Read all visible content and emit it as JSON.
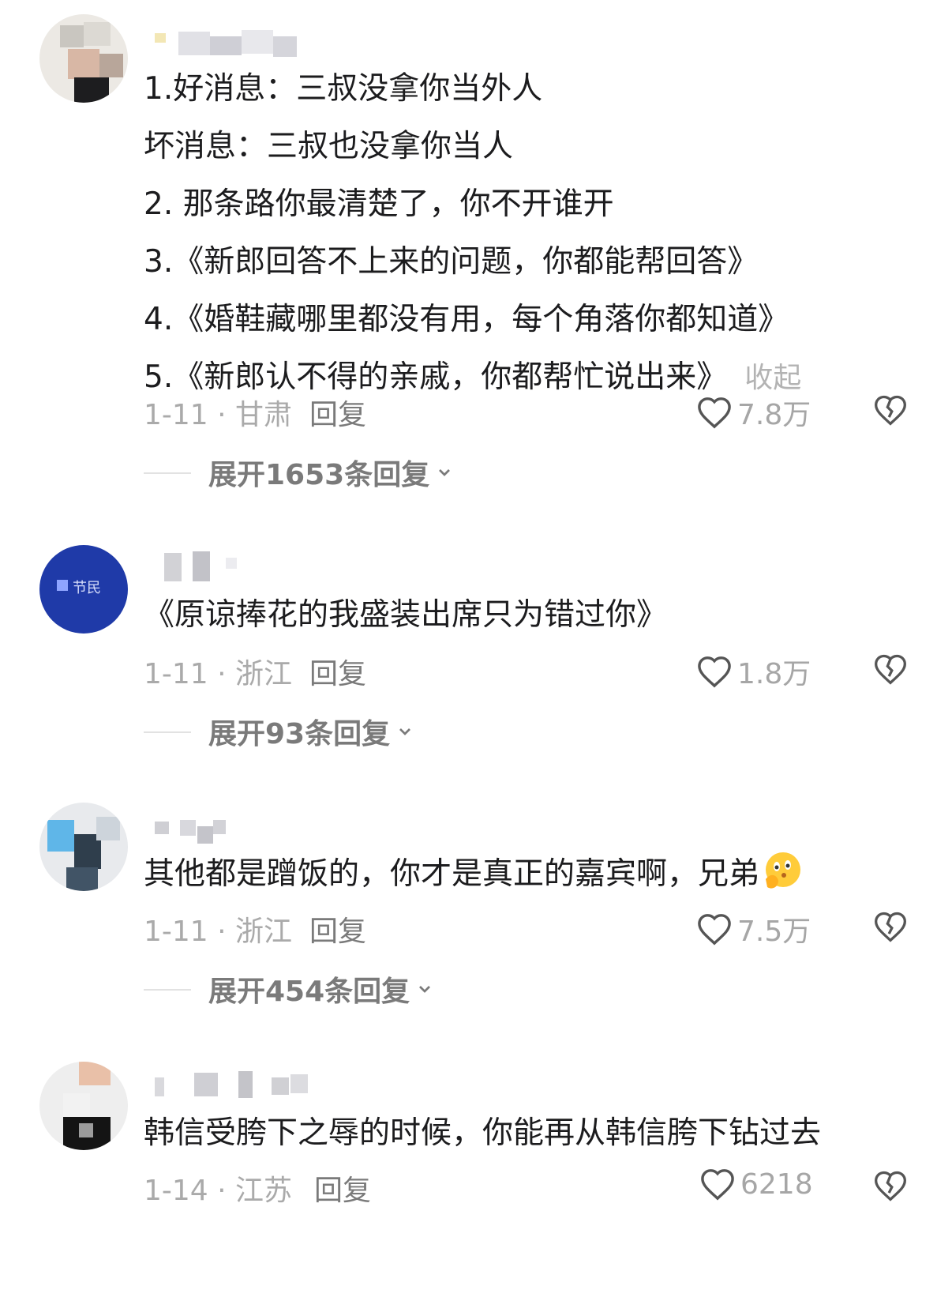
{
  "comments": [
    {
      "lines": [
        "1.好消息：三叔没拿你当外人",
        "坏消息：三叔也没拿你当人",
        "2. 那条路你最清楚了，你不开谁开",
        "3.《新郎回答不上来的问题，你都能帮回答》",
        "4.《婚鞋藏哪里都没有用，每个角落你都知道》",
        "5.《新郎认不得的亲戚，你都帮忙说出来》"
      ],
      "collapse_label": "收起",
      "date_location": "1-11 · 甘肃",
      "reply_label": "回复",
      "likes": "7.8万",
      "expand_label": "展开1653条回复"
    },
    {
      "lines": [
        "《原谅捧花的我盛装出席只为错过你》"
      ],
      "avatar_text": "节民",
      "date_location": "1-11 · 浙江",
      "reply_label": "回复",
      "likes": "1.8万",
      "expand_label": "展开93条回复"
    },
    {
      "lines": [
        "其他都是蹭饭的，你才是真正的嘉宾啊，兄弟"
      ],
      "emoji": "shushing-face-emoji",
      "date_location": "1-11 · 浙江",
      "reply_label": "回复",
      "likes": "7.5万",
      "expand_label": "展开454条回复"
    },
    {
      "lines": [
        "韩信受胯下之辱的时候，你能再从韩信胯下钻过去"
      ],
      "date_location": "1-14 · 江苏",
      "reply_label": "回复",
      "likes": "6218",
      "expand_label": ""
    }
  ],
  "icons": {
    "like": "heart-outline-icon",
    "dislike": "broken-heart-icon",
    "expand": "chevron-down-icon"
  },
  "colors": {
    "text": "#1c1c1e",
    "meta": "#aaaaaa",
    "reply": "#7a7a7a"
  }
}
